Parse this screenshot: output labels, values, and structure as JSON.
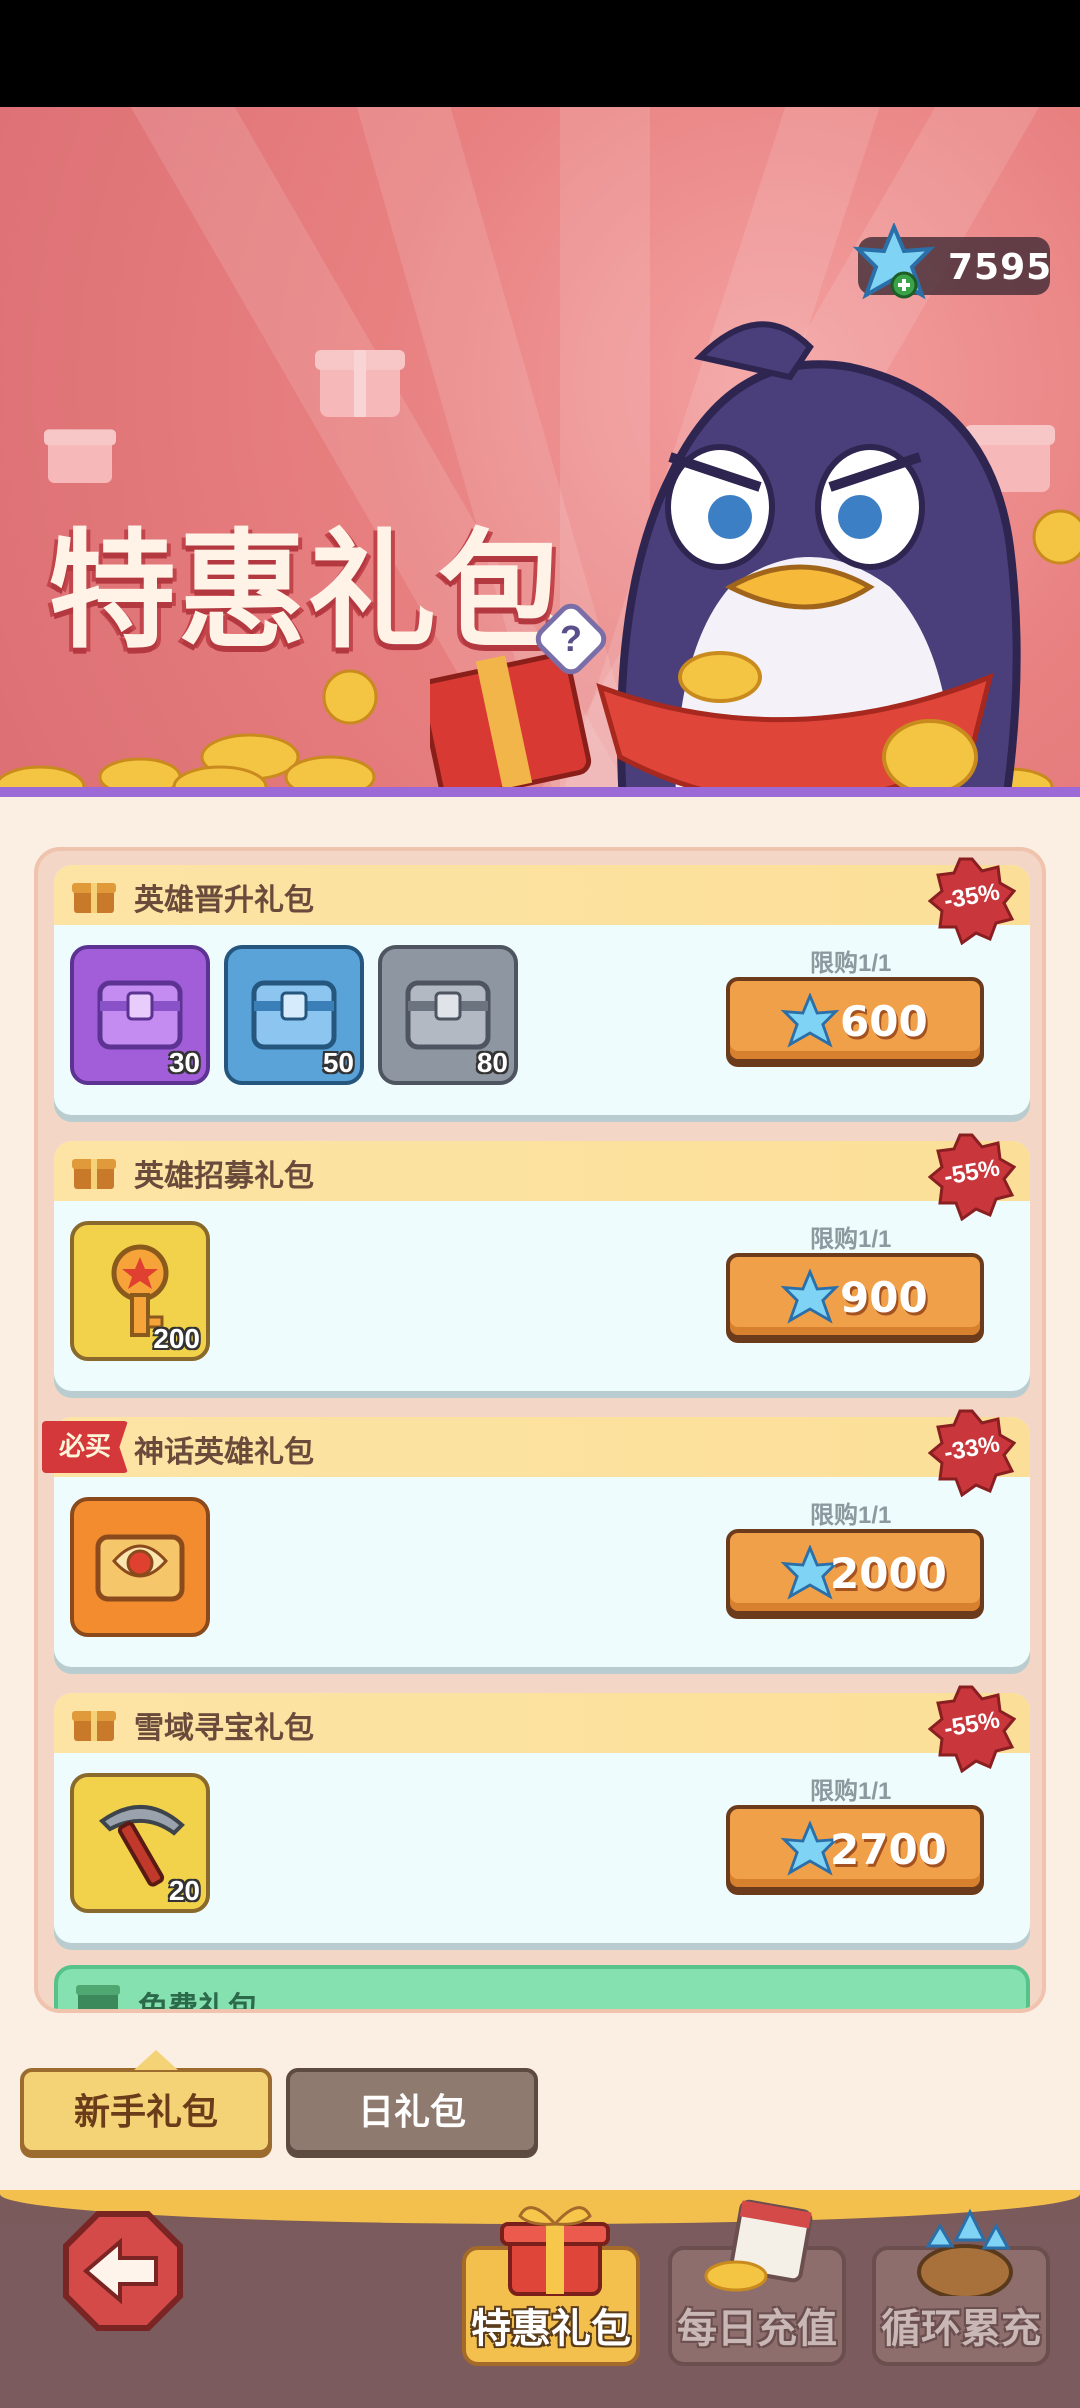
{
  "currency": {
    "amount": "7595",
    "icon": "blue-gem-icon"
  },
  "banner": {
    "title": "特惠礼包",
    "help_label": "?"
  },
  "packs": [
    {
      "title": "英雄晋升礼包",
      "discount": "-35%",
      "limit": "限购1/1",
      "price": "600",
      "badge": "",
      "items": [
        {
          "icon": "purple-chest-icon",
          "qty": "30"
        },
        {
          "icon": "blue-chest-icon",
          "qty": "50"
        },
        {
          "icon": "gray-chest-icon",
          "qty": "80"
        }
      ]
    },
    {
      "title": "英雄招募礼包",
      "discount": "-55%",
      "limit": "限购1/1",
      "price": "900",
      "badge": "",
      "items": [
        {
          "icon": "gold-key-icon",
          "qty": "200"
        }
      ]
    },
    {
      "title": "神话英雄礼包",
      "discount": "-33%",
      "limit": "限购1/1",
      "price": "2000",
      "badge": "必买",
      "items": [
        {
          "icon": "mythic-chest-icon",
          "qty": ""
        }
      ]
    },
    {
      "title": "雪域寻宝礼包",
      "discount": "-55%",
      "limit": "限购1/1",
      "price": "2700",
      "badge": "",
      "items": [
        {
          "icon": "pickaxe-icon",
          "qty": "20"
        }
      ]
    }
  ],
  "free_pack": {
    "title": "免费礼包"
  },
  "tabs": {
    "active": "新手礼包",
    "inactive": "日礼包"
  },
  "nav": {
    "special": "特惠礼包",
    "daily": "每日充值",
    "cycle": "循环累充"
  },
  "colors": {
    "button": "#f1a04a",
    "banner": "#e88080",
    "discount": "#c9363b"
  }
}
